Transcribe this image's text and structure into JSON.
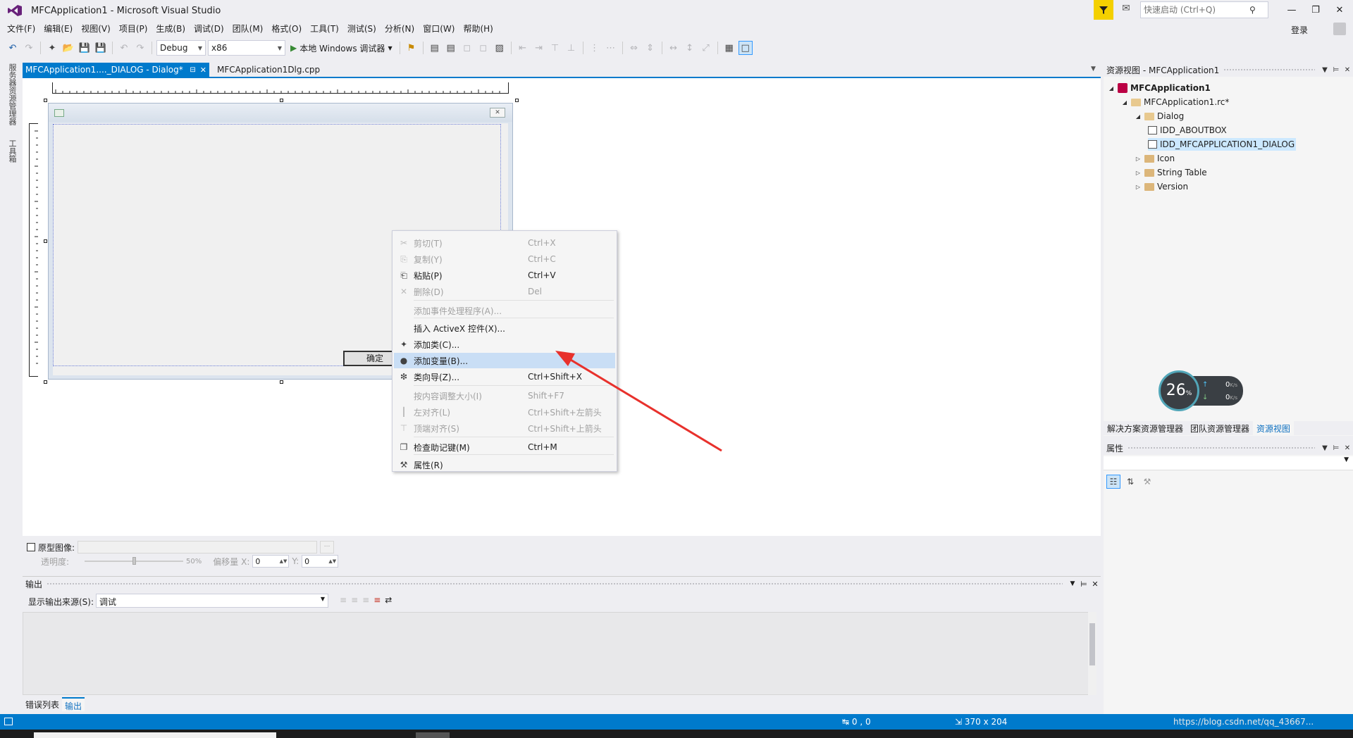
{
  "window": {
    "title": "MFCApplication1 - Microsoft Visual Studio",
    "quick_launch_placeholder": "快速启动 (Ctrl+Q)",
    "login": "登录",
    "min_glyph": "—",
    "restore_glyph": "❐",
    "close_glyph": "✕"
  },
  "menu": [
    "文件(F)",
    "编辑(E)",
    "视图(V)",
    "项目(P)",
    "生成(B)",
    "调试(D)",
    "团队(M)",
    "格式(O)",
    "工具(T)",
    "测试(S)",
    "分析(N)",
    "窗口(W)",
    "帮助(H)"
  ],
  "toolbar": {
    "config": "Debug",
    "platform": "x86",
    "debugger": "本地 Windows 调试器"
  },
  "left_strip": {
    "server_explorer": "服务器资源管理器",
    "toolbox": "工具箱"
  },
  "tabs": {
    "active": "MFCApplication1...._DIALOG - Dialog*",
    "pin": "⊟",
    "close": "✕",
    "second": "MFCApplication1Dlg.cpp"
  },
  "dialog": {
    "ok_label": "确定",
    "close_glyph": "✕"
  },
  "context_menu": {
    "items": [
      {
        "label": "剪切(T)",
        "shortcut": "Ctrl+X",
        "icon": "✂",
        "enabled": false
      },
      {
        "label": "复制(Y)",
        "shortcut": "Ctrl+C",
        "icon": "⎘",
        "enabled": false
      },
      {
        "label": "粘贴(P)",
        "shortcut": "Ctrl+V",
        "icon": "⎗",
        "enabled": true
      },
      {
        "label": "删除(D)",
        "shortcut": "Del",
        "icon": "✕",
        "enabled": false
      },
      {
        "label": "添加事件处理程序(A)...",
        "shortcut": "",
        "icon": "",
        "enabled": false
      },
      {
        "label": "插入 ActiveX 控件(X)...",
        "shortcut": "",
        "icon": "",
        "enabled": true
      },
      {
        "label": "添加类(C)...",
        "shortcut": "",
        "icon": "✦",
        "enabled": true
      },
      {
        "label": "添加变量(B)...",
        "shortcut": "",
        "icon": "●",
        "enabled": true,
        "highlighted": true
      },
      {
        "label": "类向导(Z)...",
        "shortcut": "Ctrl+Shift+X",
        "icon": "❇",
        "enabled": true
      },
      {
        "label": "按内容调整大小(I)",
        "shortcut": "Shift+F7",
        "icon": "",
        "enabled": false
      },
      {
        "label": "左对齐(L)",
        "shortcut": "Ctrl+Shift+左箭头",
        "icon": "┃",
        "enabled": false
      },
      {
        "label": "顶端对齐(S)",
        "shortcut": "Ctrl+Shift+上箭头",
        "icon": "⊤",
        "enabled": false
      },
      {
        "label": "检查助记键(M)",
        "shortcut": "Ctrl+M",
        "icon": "❐",
        "enabled": true
      },
      {
        "label": "属性(R)",
        "shortcut": "",
        "icon": "⚒",
        "enabled": true
      }
    ]
  },
  "prototype": {
    "label": "原型图像:",
    "browse": "...",
    "opacity_label": "透明度:",
    "opacity_value": "50%",
    "offset_label": "偏移量 X:",
    "x_value": "0",
    "y_label": "Y:",
    "y_value": "0"
  },
  "output": {
    "title": "输出",
    "source_label": "显示输出来源(S):",
    "source_value": "调试"
  },
  "bottom_tabs": [
    "错误列表",
    "输出"
  ],
  "resource_view": {
    "title": "资源视图 - MFCApplication1",
    "tree": [
      {
        "label": "MFCApplication1",
        "level": 0,
        "bold": true
      },
      {
        "label": "MFCApplication1.rc*",
        "level": 1
      },
      {
        "label": "Dialog",
        "level": 2
      },
      {
        "label": "IDD_ABOUTBOX",
        "level": 3
      },
      {
        "label": "IDD_MFCAPPLICATION1_DIALOG",
        "level": 3,
        "selected": true
      },
      {
        "label": "Icon",
        "level": 2
      },
      {
        "label": "String Table",
        "level": 2
      },
      {
        "label": "Version",
        "level": 2
      }
    ],
    "tabs": [
      "解决方案资源管理器",
      "团队资源管理器",
      "资源视图"
    ],
    "active_tab": "资源视图"
  },
  "net_widget": {
    "percent": "26",
    "percent_unit": "%",
    "up": "0",
    "down": "0",
    "unit": "K/s"
  },
  "properties": {
    "title": "属性"
  },
  "status": {
    "position": "0 , 0",
    "size": "370 x 204",
    "url": "https://blog.csdn.net/qq_43667..."
  }
}
